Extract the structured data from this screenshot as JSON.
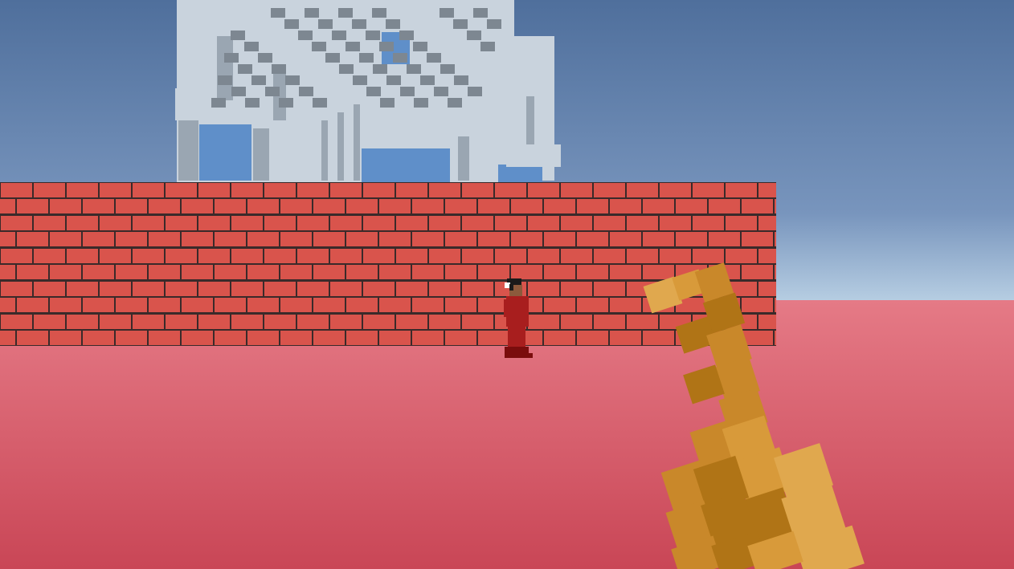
{
  "scene": {
    "view": "first-person",
    "sky": {
      "top_color": "#4f6f9c",
      "horizon_color": "#b9d0e4"
    },
    "ground": {
      "color": "#d95e6c",
      "near_color": "#c94656"
    },
    "wall": {
      "brick_color": "#d9544c",
      "mortar_color": "#3a2a2a",
      "material": "brick"
    },
    "building": {
      "color": "#c9d3dd",
      "shadow_color": "#9aa6b2",
      "window_color": "#5f8fc9",
      "style": "voxel"
    },
    "character": {
      "outfit_color": "#a81e1e",
      "hair_color": "#1a1a1a",
      "skin_color": "#8c5a3c"
    },
    "held_item": {
      "name": "golden-key",
      "colors": [
        "#e0a84e",
        "#c9882a",
        "#b07416",
        "#d89a3a"
      ]
    }
  },
  "hud": {}
}
